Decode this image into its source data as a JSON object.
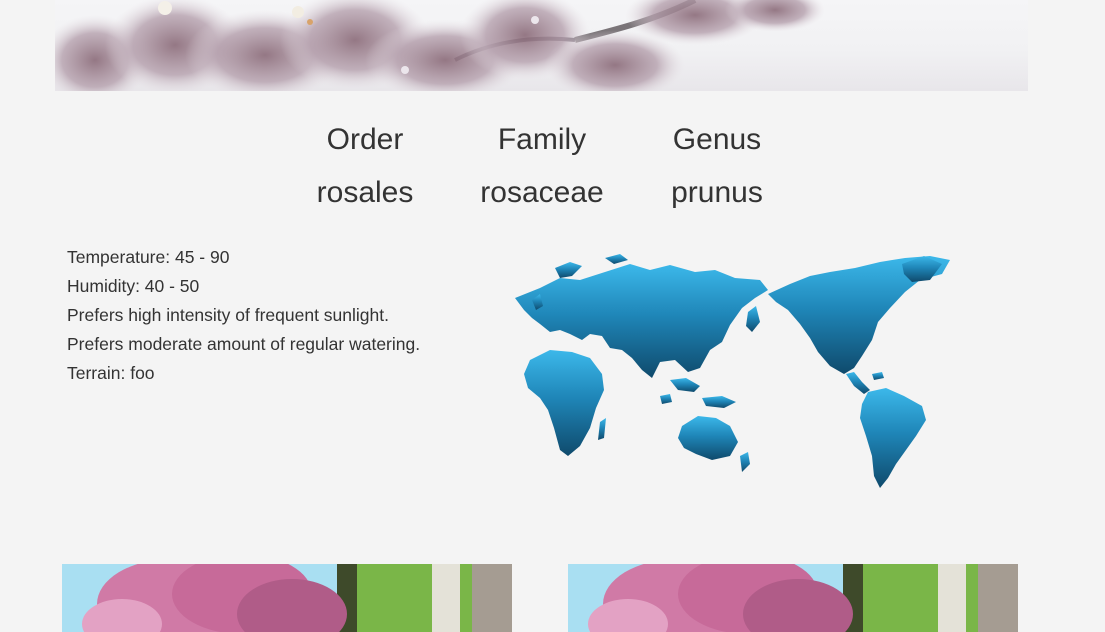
{
  "hero": {
    "image_subject": "cherry blossom branches photo"
  },
  "taxonomy": {
    "order": {
      "label": "Order",
      "value": "rosales"
    },
    "family": {
      "label": "Family",
      "value": "rosaceae"
    },
    "genus": {
      "label": "Genus",
      "value": "prunus"
    }
  },
  "care": {
    "temperature": "Temperature: 45 - 90",
    "humidity": "Humidity: 40 - 50",
    "sunlight": "Prefers high intensity of frequent sunlight.",
    "watering": "Prefers moderate amount of regular watering.",
    "terrain": "Terrain: foo"
  },
  "map": {
    "image_subject": "world map",
    "color_top": "#3cb8ea",
    "color_bottom": "#0f4a6c"
  },
  "gallery": [
    {
      "image_subject": "pink cherry blossom tree beside a path"
    },
    {
      "image_subject": "pink cherry blossom tree beside a path"
    }
  ],
  "colors": {
    "background": "#f4f4f4",
    "text": "#333333",
    "blossom": "#d07aa6"
  }
}
